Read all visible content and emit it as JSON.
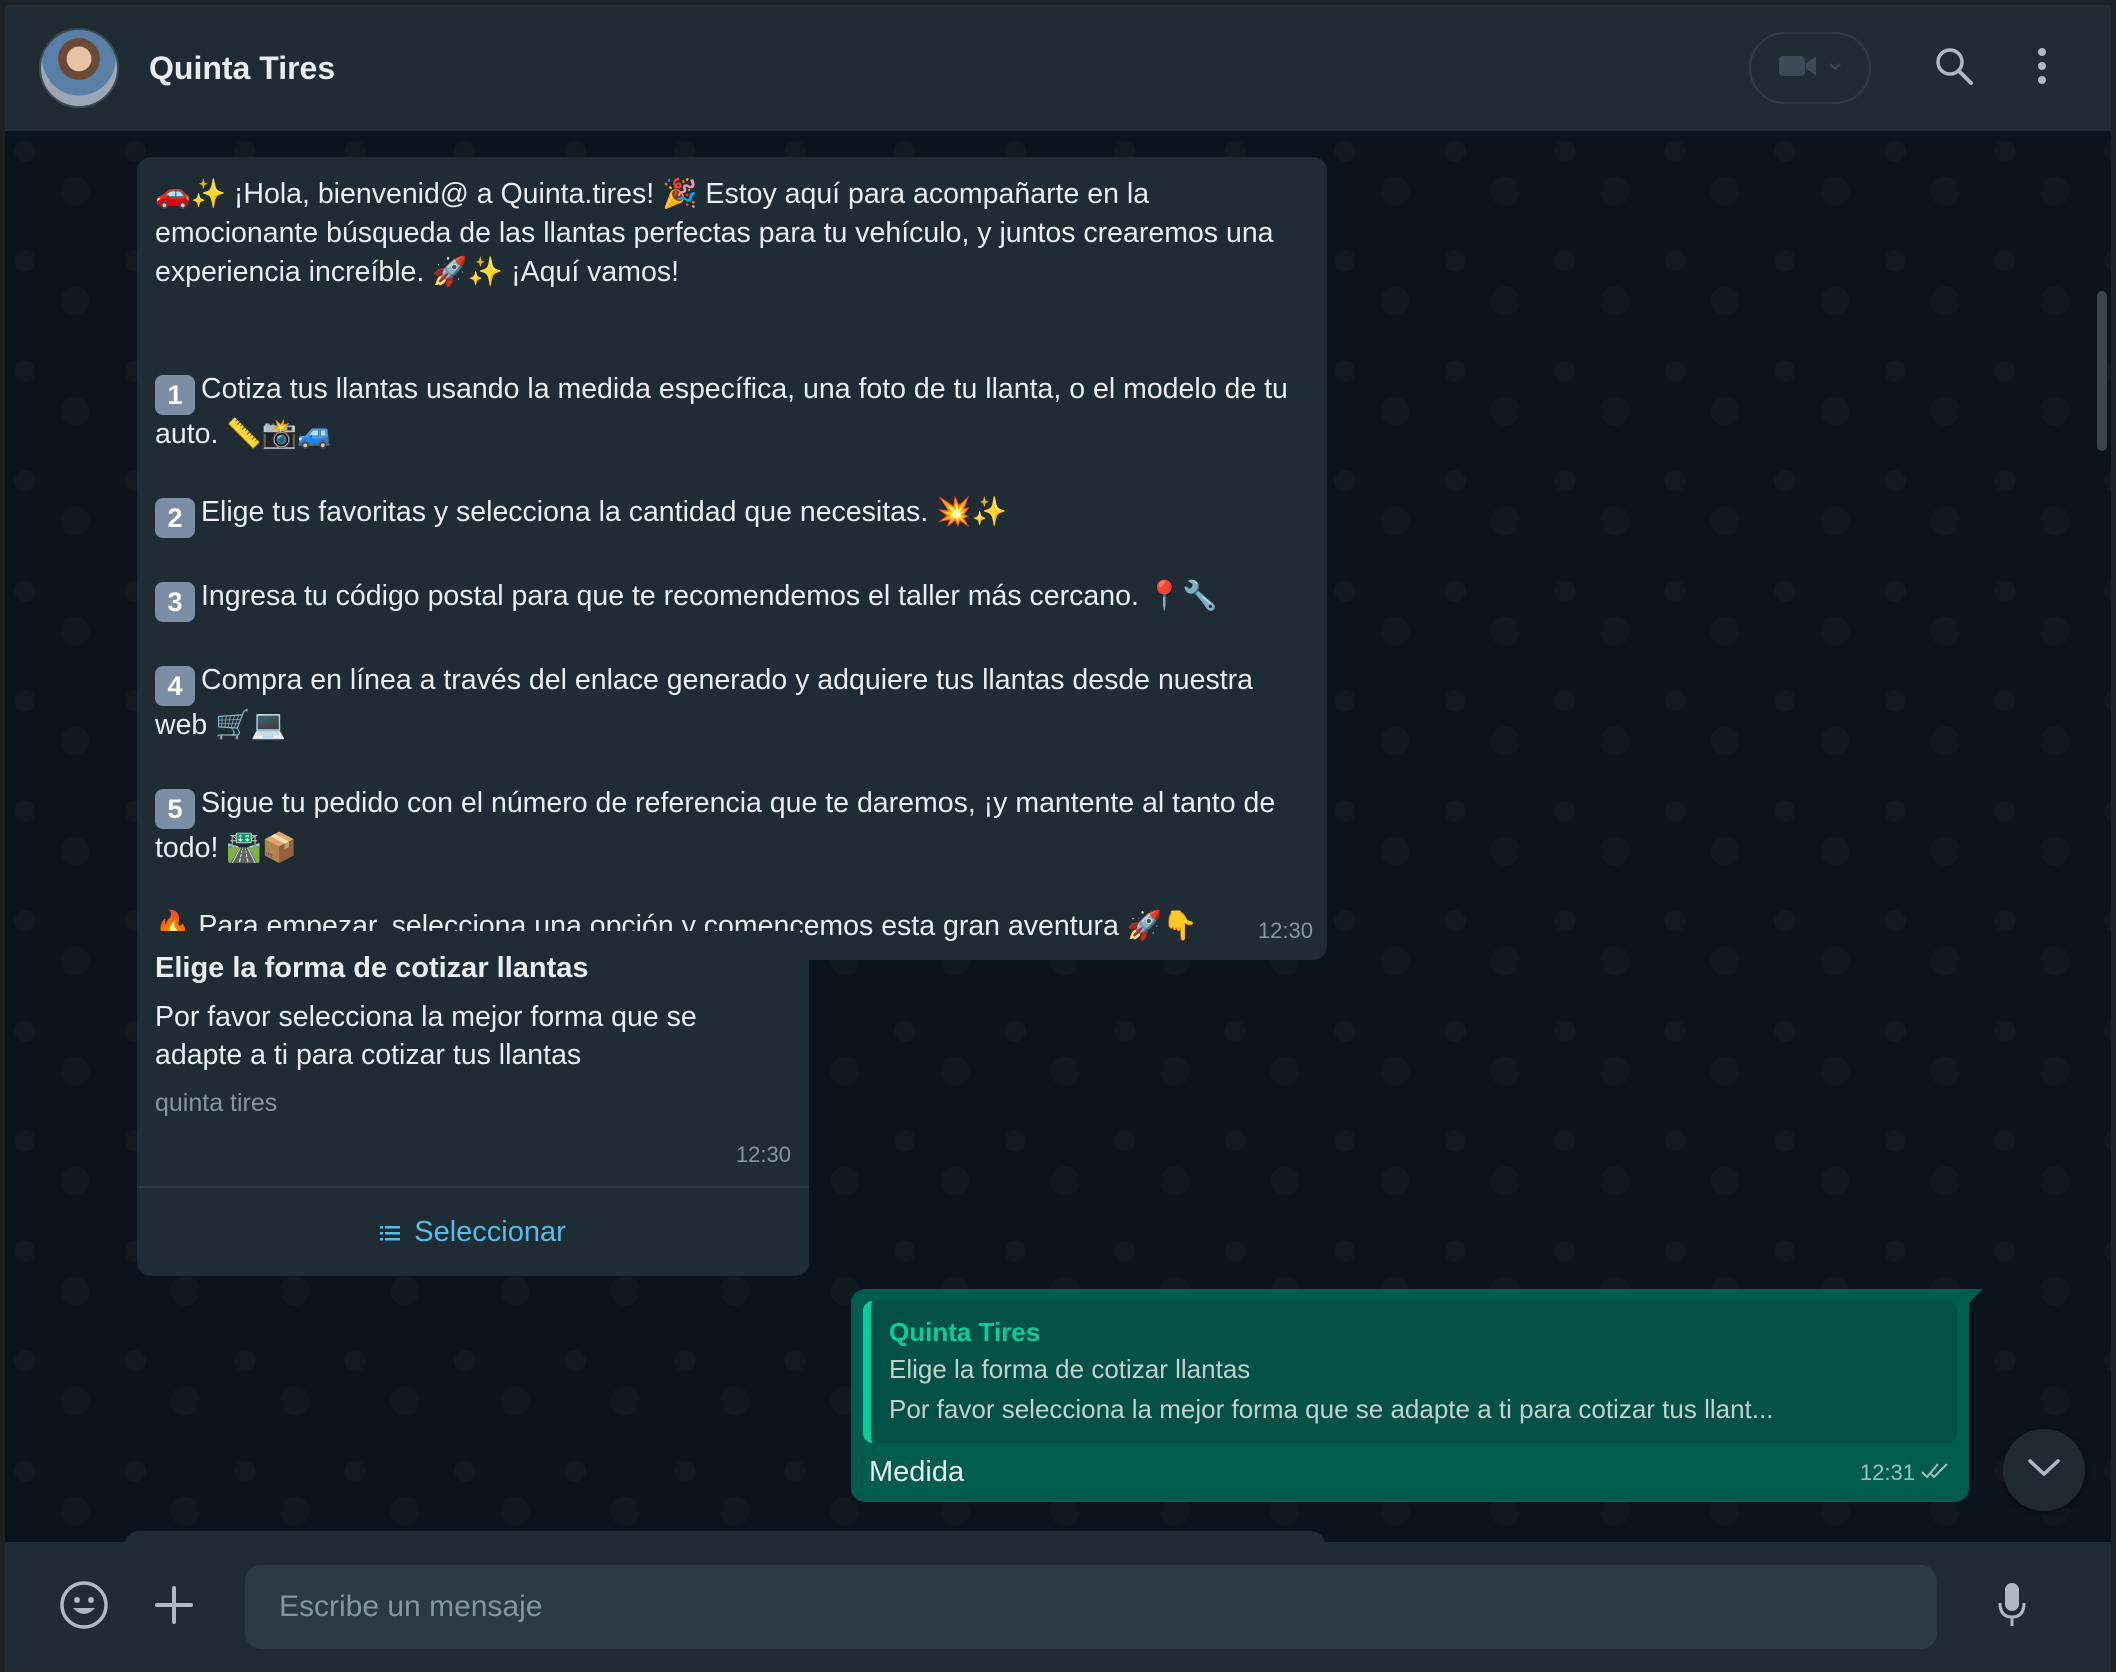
{
  "header": {
    "contact_name": "Quinta Tires"
  },
  "welcome_message": {
    "intro": "🚗✨ ¡Hola, bienvenid@ a Quinta.tires! 🎉 Estoy aquí para acompañarte en la emocionante búsqueda de las llantas perfectas para tu vehículo, y juntos crearemos una experiencia increíble. 🚀✨ ¡Aquí vamos!",
    "steps": [
      {
        "number": "1",
        "text": "Cotiza tus llantas usando la medida específica, una foto de tu llanta, o el modelo de tu auto. 📏📸🚙"
      },
      {
        "number": "2",
        "text": "Elige tus favoritas y selecciona la cantidad que necesitas. 💥✨"
      },
      {
        "number": "3",
        "text": "Ingresa tu código postal para que te recomendemos el taller más cercano. 📍🔧"
      },
      {
        "number": "4",
        "text": "Compra en línea a través del enlace generado y adquiere tus llantas desde nuestra web 🛒💻"
      },
      {
        "number": "5",
        "text": "Sigue tu pedido con el número de referencia que te daremos, ¡y mantente al tanto de todo! 🛣️📦"
      }
    ],
    "closing": "🔥 Para empezar, selecciona una opción y comencemos esta gran aventura 🚀👇",
    "time": "12:30"
  },
  "list_message": {
    "title": "Elige la forma de cotizar llantas",
    "body": "Por favor selecciona la mejor forma que se adapte a ti para cotizar tus llantas",
    "footer": "quinta tires",
    "time": "12:30",
    "button_label": "Seleccionar"
  },
  "reply_message": {
    "quoted_name": "Quinta Tires",
    "quoted_title": "Elige la forma de cotizar llantas",
    "quoted_body": "Por favor selecciona la mejor forma que se adapte a ti para cotizar tus llant...",
    "text": "Medida",
    "time": "12:31",
    "status": "read"
  },
  "composer": {
    "placeholder": "Escribe un mensaje"
  },
  "colors": {
    "background": "#0b141a",
    "panel": "#202c33",
    "incoming_bubble": "#202c33",
    "outgoing_bubble": "#005c4b",
    "accent_green": "#06cf9c",
    "link_blue": "#53bdeb"
  },
  "icons": [
    "video-call-icon",
    "chevron-down-icon",
    "search-icon",
    "menu-icon",
    "list-icon",
    "double-check-icon",
    "emoji-icon",
    "plus-icon",
    "mic-icon"
  ]
}
